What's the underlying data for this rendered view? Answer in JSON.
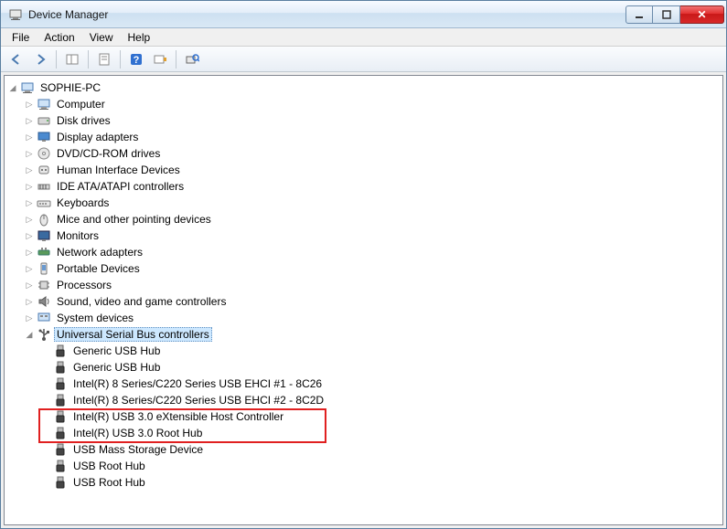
{
  "window": {
    "title": "Device Manager"
  },
  "menu": {
    "file": "File",
    "action": "Action",
    "view": "View",
    "help": "Help"
  },
  "tree": {
    "root": "SOPHIE-PC",
    "categories": [
      {
        "label": "Computer",
        "icon": "computer",
        "expanded": false
      },
      {
        "label": "Disk drives",
        "icon": "disk",
        "expanded": false
      },
      {
        "label": "Display adapters",
        "icon": "display",
        "expanded": false
      },
      {
        "label": "DVD/CD-ROM drives",
        "icon": "dvd",
        "expanded": false
      },
      {
        "label": "Human Interface Devices",
        "icon": "hid",
        "expanded": false
      },
      {
        "label": "IDE ATA/ATAPI controllers",
        "icon": "ide",
        "expanded": false
      },
      {
        "label": "Keyboards",
        "icon": "keyboard",
        "expanded": false
      },
      {
        "label": "Mice and other pointing devices",
        "icon": "mouse",
        "expanded": false
      },
      {
        "label": "Monitors",
        "icon": "monitor",
        "expanded": false
      },
      {
        "label": "Network adapters",
        "icon": "network",
        "expanded": false
      },
      {
        "label": "Portable Devices",
        "icon": "portable",
        "expanded": false
      },
      {
        "label": "Processors",
        "icon": "cpu",
        "expanded": false
      },
      {
        "label": "Sound, video and game controllers",
        "icon": "sound",
        "expanded": false
      },
      {
        "label": "System devices",
        "icon": "system",
        "expanded": false
      },
      {
        "label": "Universal Serial Bus controllers",
        "icon": "usb",
        "expanded": true,
        "selected": true,
        "children": [
          {
            "label": "Generic USB Hub",
            "icon": "usbdev"
          },
          {
            "label": "Generic USB Hub",
            "icon": "usbdev"
          },
          {
            "label": "Intel(R) 8 Series/C220 Series USB EHCI #1 - 8C26",
            "icon": "usbdev"
          },
          {
            "label": "Intel(R) 8 Series/C220 Series USB EHCI #2 - 8C2D",
            "icon": "usbdev"
          },
          {
            "label": "Intel(R) USB 3.0 eXtensible Host Controller",
            "icon": "usbdev",
            "highlighted": true
          },
          {
            "label": "Intel(R) USB 3.0 Root Hub",
            "icon": "usbdev",
            "highlighted": true
          },
          {
            "label": "USB Mass Storage Device",
            "icon": "usbdev"
          },
          {
            "label": "USB Root Hub",
            "icon": "usbdev"
          },
          {
            "label": "USB Root Hub",
            "icon": "usbdev"
          }
        ]
      }
    ]
  },
  "highlight_color": "#e02020"
}
